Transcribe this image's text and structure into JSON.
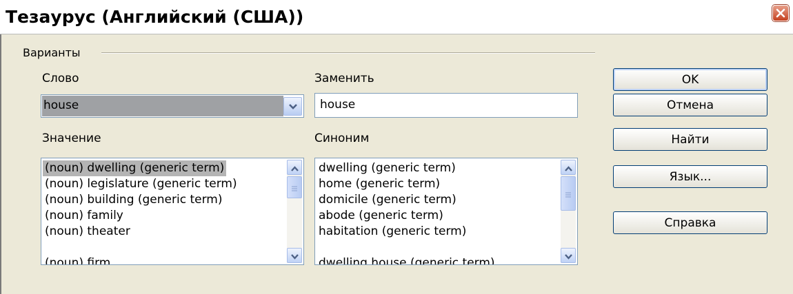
{
  "window": {
    "title": "Тезаурус (Английский (США))",
    "close_icon": "close-icon",
    "close_color": "#c5411f"
  },
  "variants": {
    "group_label": "Варианты",
    "word_label": "Слово",
    "word_value": "house",
    "replace_label": "Заменить",
    "replace_value": "house",
    "meaning_label": "Значение",
    "synonym_label": "Синоним",
    "meanings": [
      "(noun) dwelling (generic term)",
      "(noun) legislature (generic term)",
      "(noun) building (generic term)",
      "(noun) family",
      "(noun) theater",
      "(noun) firm"
    ],
    "synonyms": [
      "dwelling (generic term)",
      "home (generic term)",
      "domicile (generic term)",
      "abode (generic term)",
      "habitation (generic term)",
      "dwelling house (generic term)"
    ]
  },
  "buttons": {
    "ok": "OK",
    "cancel": "Отмена",
    "search": "Найти",
    "language": "Язык...",
    "help": "Справка"
  }
}
